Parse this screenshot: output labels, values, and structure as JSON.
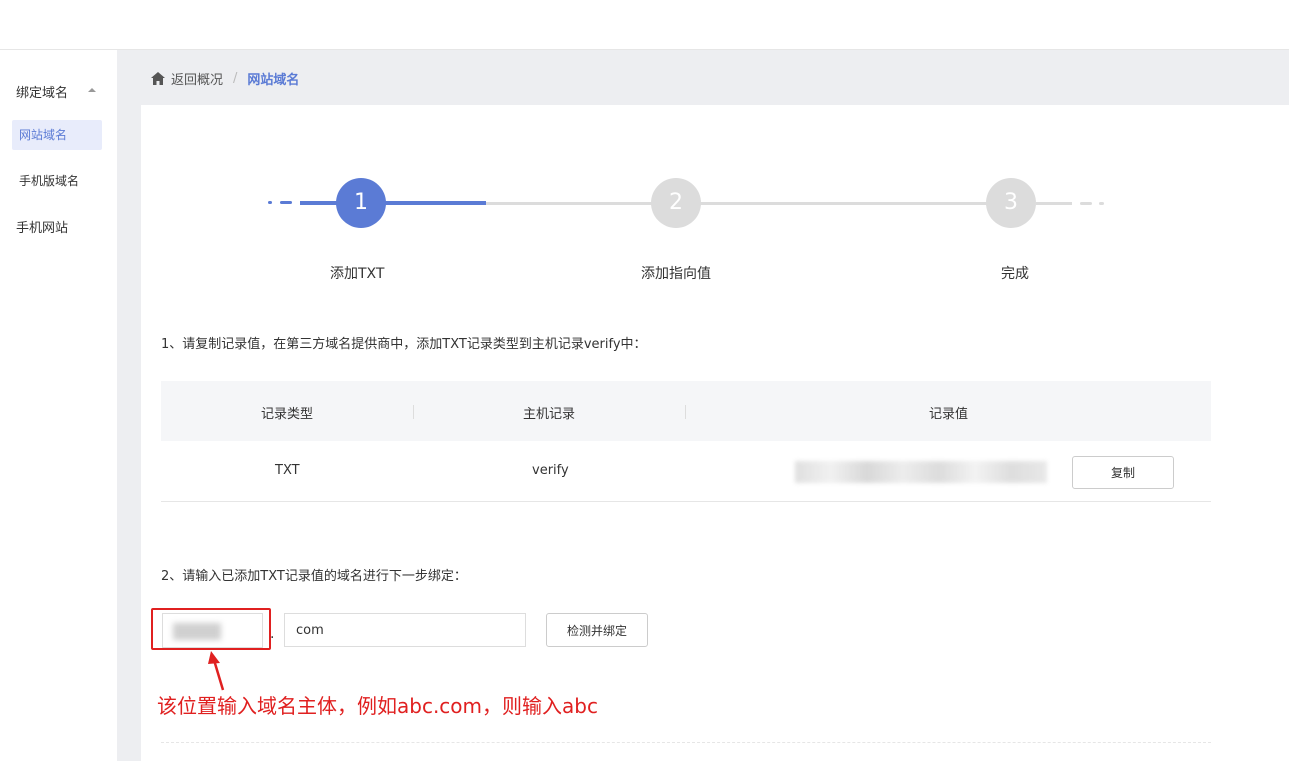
{
  "sidebar": {
    "group_label": "绑定域名",
    "items": [
      {
        "label": "网站域名",
        "active": true
      },
      {
        "label": "手机版域名"
      },
      {
        "label": "手机网站"
      }
    ]
  },
  "breadcrumb": {
    "back_label": "返回概况",
    "separator": "/",
    "current": "网站域名"
  },
  "steps": [
    {
      "number": "1",
      "label": "添加TXT",
      "state": "active"
    },
    {
      "number": "2",
      "label": "添加指向值",
      "state": "pending"
    },
    {
      "number": "3",
      "label": "完成",
      "state": "pending"
    }
  ],
  "step1": {
    "instruction": "1、请复制记录值，在第三方域名提供商中，添加TXT记录类型到主机记录verify中：",
    "table": {
      "headers": [
        "记录类型",
        "主机记录",
        "记录值"
      ],
      "rows": [
        {
          "type": "TXT",
          "host": "verify",
          "value_blurred": true
        }
      ],
      "copy_button": "复制"
    }
  },
  "step2": {
    "instruction": "2、请输入已添加TXT记录值的域名进行下一步绑定：",
    "domain_separator": ".",
    "suffix_value": "com",
    "bind_button": "检测并绑定"
  },
  "annotation": "该位置输入域名主体，例如abc.com，则输入abc",
  "colors": {
    "accent": "#5b7bd5",
    "pending": "#dcdcdc",
    "annotation": "#e02020"
  }
}
